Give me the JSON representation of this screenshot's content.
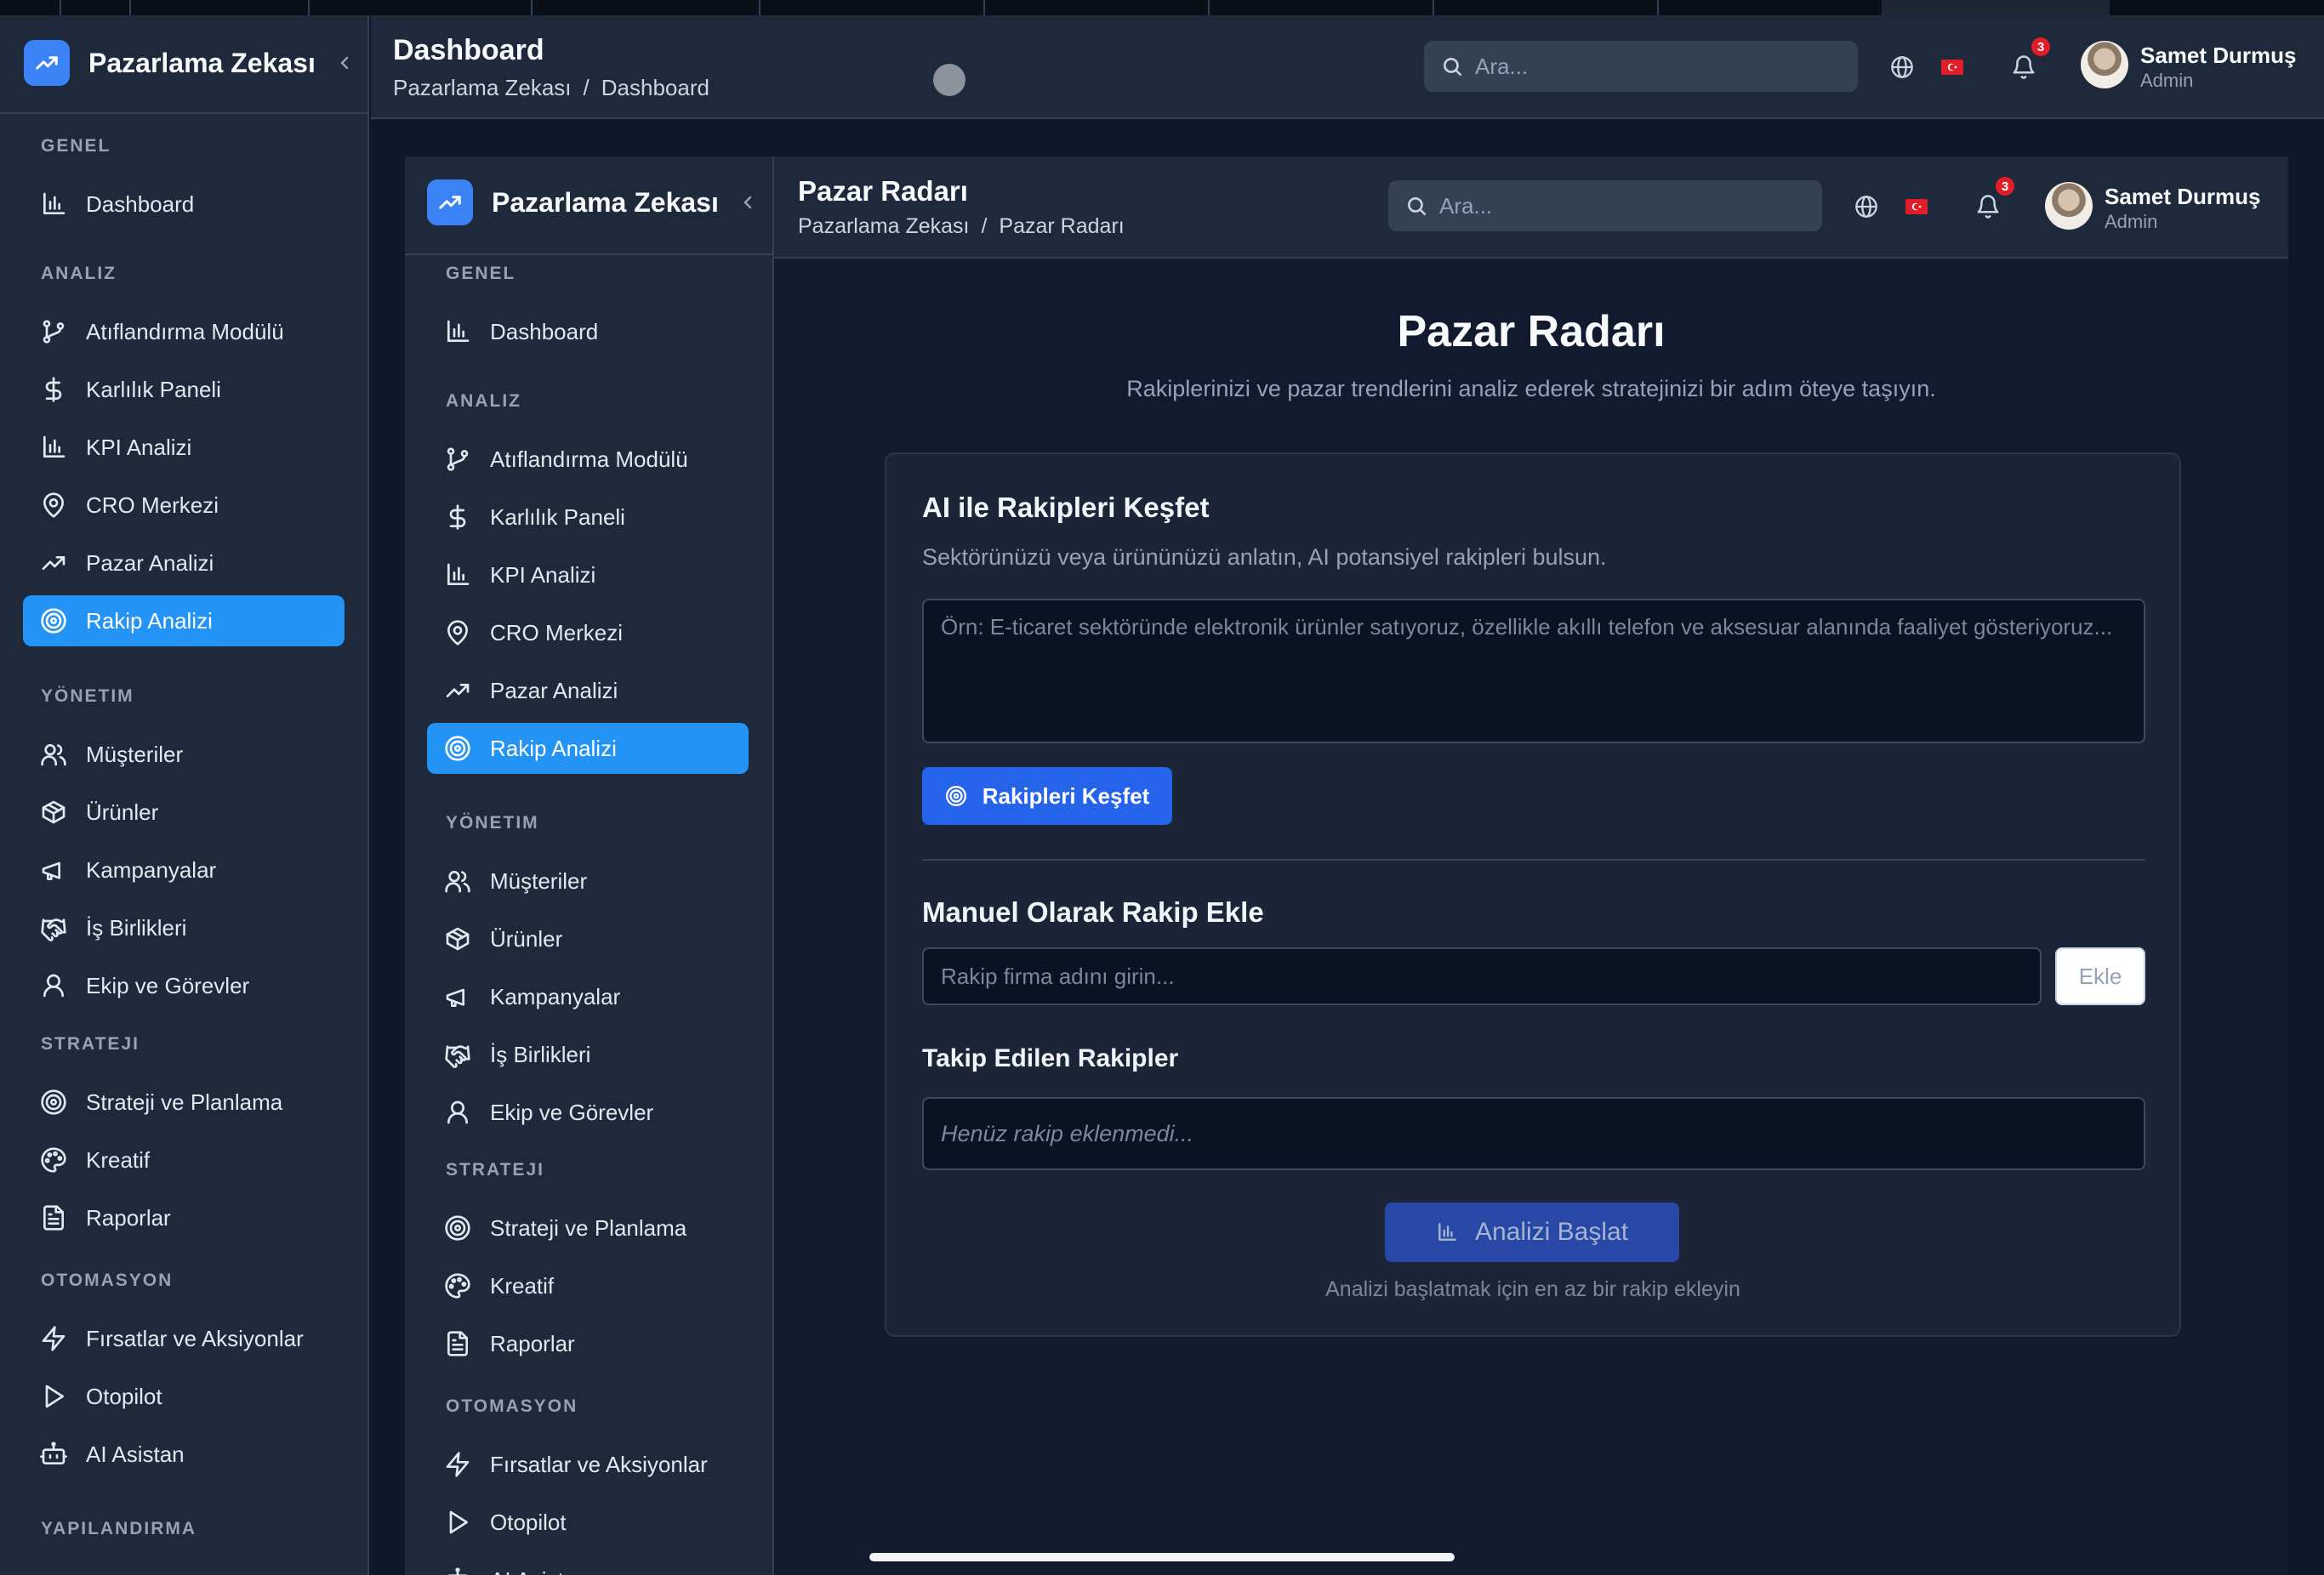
{
  "brand": {
    "name": "Pazarlama Zekası"
  },
  "nav": {
    "sections": [
      {
        "title": "GENEL",
        "items": [
          {
            "label": "Dashboard",
            "icon": "bar-chart-icon"
          }
        ]
      },
      {
        "title": "ANALIZ",
        "items": [
          {
            "label": "Atıflandırma Modülü",
            "icon": "git-branch-icon"
          },
          {
            "label": "Karlılık Paneli",
            "icon": "dollar-icon"
          },
          {
            "label": "KPI Analizi",
            "icon": "bar-chart-icon"
          },
          {
            "label": "CRO Merkezi",
            "icon": "map-pin-icon"
          },
          {
            "label": "Pazar Analizi",
            "icon": "trending-up-icon"
          },
          {
            "label": "Rakip Analizi",
            "icon": "target-icon",
            "active": true
          }
        ]
      },
      {
        "title": "YÖNETIM",
        "items": [
          {
            "label": "Müşteriler",
            "icon": "users-icon"
          },
          {
            "label": "Ürünler",
            "icon": "package-icon"
          },
          {
            "label": "Kampanyalar",
            "icon": "megaphone-icon"
          },
          {
            "label": "İş Birlikleri",
            "icon": "handshake-icon"
          },
          {
            "label": "Ekip ve Görevler",
            "icon": "user-icon"
          }
        ]
      },
      {
        "title": "STRATEJI",
        "items": [
          {
            "label": "Strateji ve Planlama",
            "icon": "target-icon"
          },
          {
            "label": "Kreatif",
            "icon": "palette-icon"
          },
          {
            "label": "Raporlar",
            "icon": "file-text-icon"
          }
        ]
      },
      {
        "title": "OTOMASYON",
        "items": [
          {
            "label": "Fırsatlar ve Aksiyonlar",
            "icon": "zap-icon"
          },
          {
            "label": "Otopilot",
            "icon": "play-icon"
          },
          {
            "label": "AI Asistan",
            "icon": "bot-icon"
          }
        ]
      },
      {
        "title": "YAPILANDIRMA",
        "items": []
      }
    ]
  },
  "outer_header": {
    "title": "Dashboard",
    "breadcrumb": [
      "Pazarlama Zekası",
      "/",
      "Dashboard"
    ],
    "search_placeholder": "Ara...",
    "notifications": "3",
    "user_name": "Samet Durmuş",
    "user_role": "Admin"
  },
  "inner_header": {
    "title": "Pazar Radarı",
    "breadcrumb": [
      "Pazarlama Zekası",
      "/",
      "Pazar Radarı"
    ],
    "search_placeholder": "Ara...",
    "notifications": "3",
    "user_name": "Samet Durmuş",
    "user_role": "Admin"
  },
  "content": {
    "title": "Pazar Radarı",
    "subtitle": "Rakiplerinizi ve pazar trendlerini analiz ederek stratejinizi bir adım öteye taşıyın.",
    "ai_section": {
      "heading": "AI ile Rakipleri Keşfet",
      "description": "Sektörünüzü veya ürününüzü anlatın, AI potansiyel rakipleri bulsun.",
      "textarea_placeholder": "Örn: E-ticaret sektöründe elektronik ürünler satıyoruz, özellikle akıllı telefon ve aksesuar alanında faaliyet gösteriyoruz...",
      "button_label": "Rakipleri Keşfet"
    },
    "manual_section": {
      "heading": "Manuel Olarak Rakip Ekle",
      "input_placeholder": "Rakip firma adını girin...",
      "add_label": "Ekle"
    },
    "tracked_section": {
      "heading": "Takip Edilen Rakipler",
      "empty_text": "Henüz rakip eklenmedi..."
    },
    "analyze_label": "Analizi Başlat",
    "analyze_hint": "Analizi başlatmak için en az bir rakip ekleyin"
  },
  "colors": {
    "accent": "#2394f5",
    "primary_button": "#2563eb",
    "background": "#0f172a",
    "panel": "#1e293b",
    "badge": "#e11d2a"
  }
}
